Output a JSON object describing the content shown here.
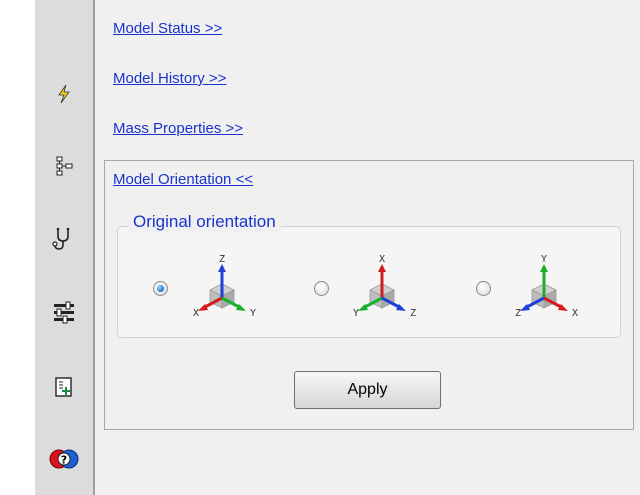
{
  "links": {
    "model_status": "Model Status >>",
    "model_history": "Model History >>",
    "mass_properties": "Mass Properties >>",
    "model_orientation": "Model Orientation <<"
  },
  "orientation": {
    "group_label": "Original orientation",
    "options": [
      {
        "top": "Z",
        "left": "X",
        "right": "Y",
        "selected": true
      },
      {
        "top": "X",
        "left": "Y",
        "right": "Z",
        "selected": false
      },
      {
        "top": "Y",
        "left": "Z",
        "right": "X",
        "selected": false
      }
    ],
    "apply_label": "Apply"
  },
  "toolbar": {
    "items": [
      "lightning-icon",
      "hierarchy-icon",
      "stethoscope-icon",
      "sliders-icon",
      "add-page-icon",
      "help-icon"
    ]
  },
  "colors": {
    "link": "#1a33cc",
    "toolbar_bg": "#dcdcdc",
    "panel_bg": "#f0f0f0"
  }
}
